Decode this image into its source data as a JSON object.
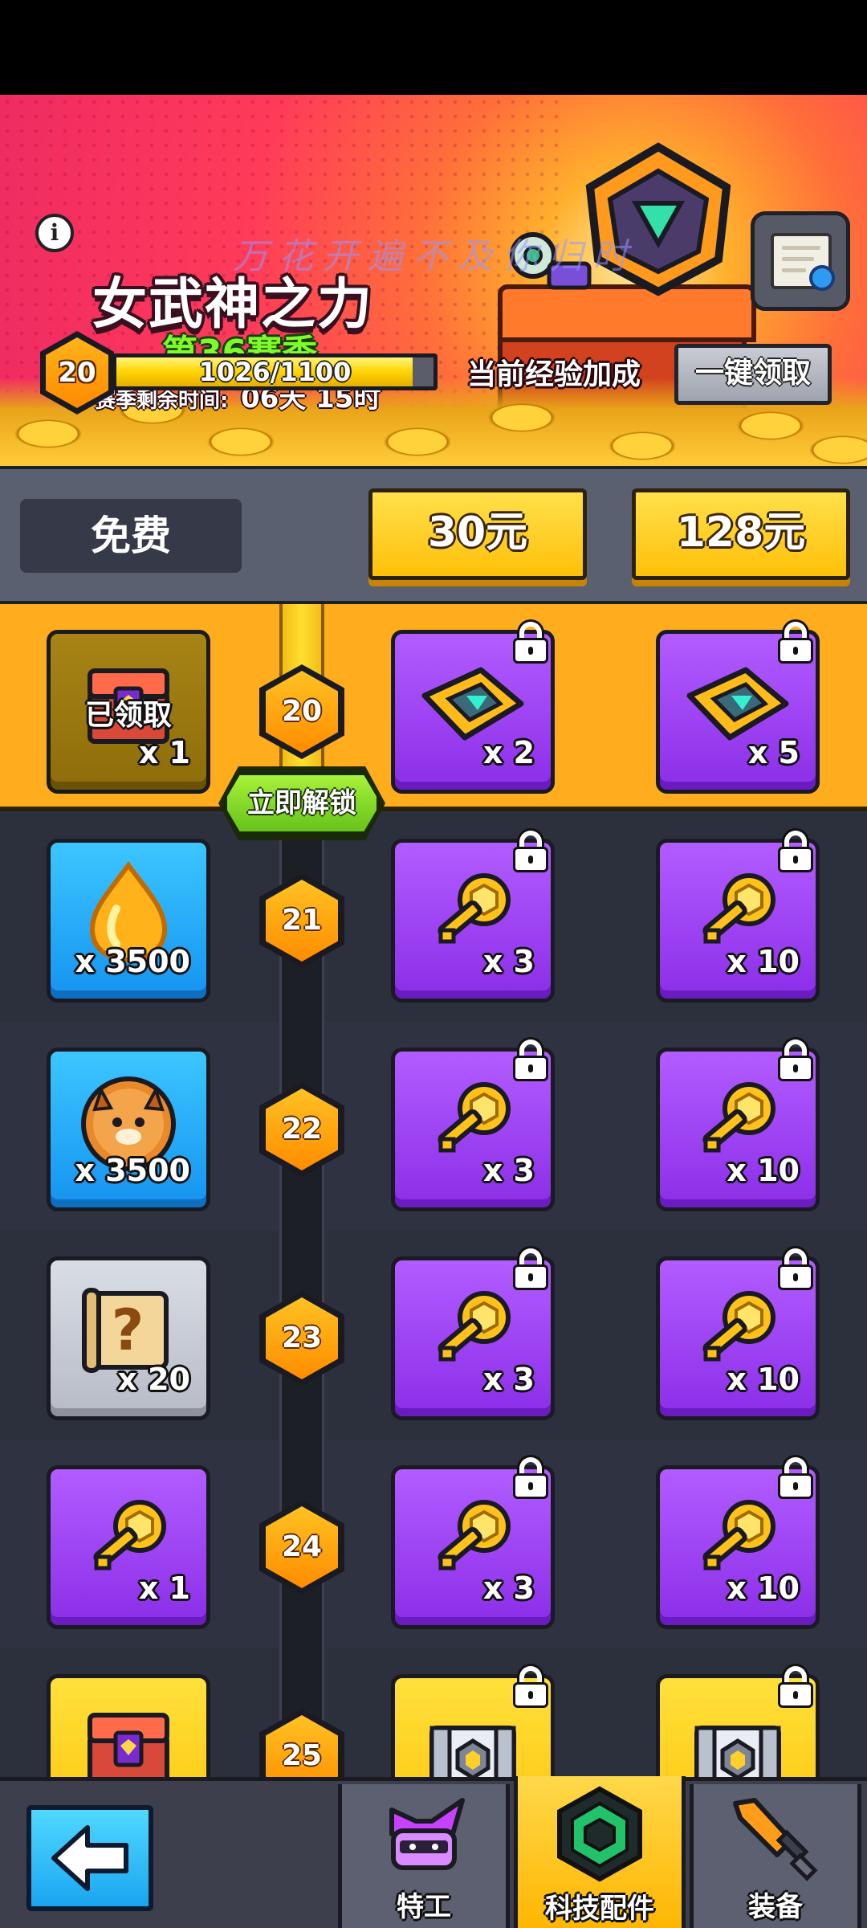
{
  "banner": {
    "title": "女武神之力",
    "season": "第36赛季",
    "time_label": "赛季剩余时间:",
    "time_value": "06天 15时",
    "watermark": "万花开遍不及你归时",
    "level": "20",
    "xp_text": "1026/1100",
    "xp_progress": 0.933,
    "exp_bonus_label": "当前经验加成",
    "claim_all_label": "一键领取"
  },
  "tiers": {
    "free": "免费",
    "tier1": "30元",
    "tier2": "128元"
  },
  "unlock_button": "立即解锁",
  "claimed_label": "已领取",
  "rows": [
    {
      "level": "20",
      "free": {
        "icon": "chest-icon",
        "qty": "x 1",
        "claimed": true,
        "color": "claimed"
      },
      "t1": {
        "icon": "tech-chip-icon",
        "qty": "x 2",
        "color": "purple",
        "locked": true
      },
      "t2": {
        "icon": "tech-chip-icon",
        "qty": "x 5",
        "color": "purple",
        "locked": true
      }
    },
    {
      "level": "21",
      "free": {
        "icon": "energy-drop-icon",
        "qty": "x 3500",
        "color": "blue"
      },
      "t1": {
        "icon": "golden-key-icon",
        "qty": "x 3",
        "color": "purple",
        "locked": true
      },
      "t2": {
        "icon": "golden-key-icon",
        "qty": "x 10",
        "color": "purple",
        "locked": true
      }
    },
    {
      "level": "22",
      "free": {
        "icon": "dog-cookie-icon",
        "qty": "x 3500",
        "color": "blue"
      },
      "t1": {
        "icon": "golden-key-icon",
        "qty": "x 3",
        "color": "purple",
        "locked": true
      },
      "t2": {
        "icon": "golden-key-icon",
        "qty": "x 10",
        "color": "purple",
        "locked": true
      }
    },
    {
      "level": "23",
      "free": {
        "icon": "mystery-scroll-icon",
        "qty": "x 20",
        "color": "gray"
      },
      "t1": {
        "icon": "golden-key-icon",
        "qty": "x 3",
        "color": "purple",
        "locked": true
      },
      "t2": {
        "icon": "golden-key-icon",
        "qty": "x 10",
        "color": "purple",
        "locked": true
      }
    },
    {
      "level": "24",
      "free": {
        "icon": "golden-key-icon",
        "qty": "x 1",
        "color": "purple"
      },
      "t1": {
        "icon": "golden-key-icon",
        "qty": "x 3",
        "color": "purple",
        "locked": true
      },
      "t2": {
        "icon": "golden-key-icon",
        "qty": "x 10",
        "color": "purple",
        "locked": true
      }
    },
    {
      "level": "25",
      "free": {
        "icon": "chest-icon",
        "qty": "",
        "color": "gold"
      },
      "t1": {
        "icon": "silver-chest-icon",
        "qty": "",
        "color": "gold",
        "locked": true
      },
      "t2": {
        "icon": "silver-chest-icon",
        "qty": "",
        "color": "gold",
        "locked": true
      }
    }
  ],
  "nav": {
    "tab_agent": "特工",
    "tab_tech": "科技配件",
    "tab_equipment": "装备",
    "active": "tab_tech"
  },
  "colors": {
    "accent_gold": "#ffc40d",
    "reward_purple": "#8b2ee8",
    "reward_blue": "#1593f0",
    "unlock_green": "#66c21a"
  }
}
